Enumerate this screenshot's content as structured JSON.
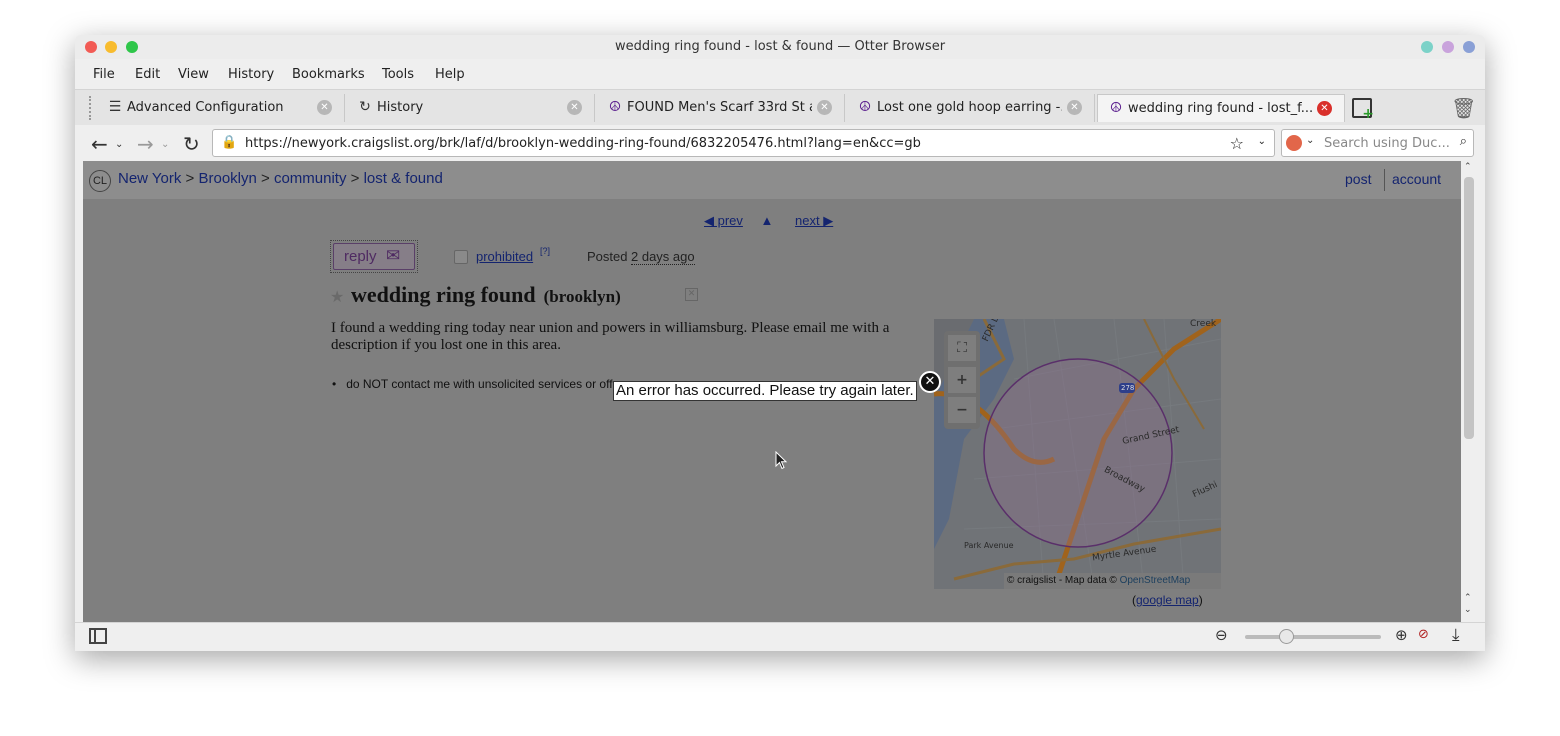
{
  "window": {
    "title": "wedding ring found - lost & found — Otter Browser"
  },
  "menu": [
    "File",
    "Edit",
    "View",
    "History",
    "Bookmarks",
    "Tools",
    "Help"
  ],
  "tabs": [
    {
      "label": "Advanced Configuration",
      "icon": "sliders-icon"
    },
    {
      "label": "History",
      "icon": "history-icon"
    },
    {
      "label": "FOUND Men's Scarf 33rd St a...",
      "icon": "peace-icon"
    },
    {
      "label": "Lost one gold hoop earring -...",
      "icon": "peace-icon"
    },
    {
      "label": "wedding ring found - lost_f...",
      "icon": "peace-icon"
    }
  ],
  "nav": {
    "url": "https://newyork.craigslist.org/brk/laf/d/brooklyn-wedding-ring-found/6832205476.html?lang=en&cc=gb",
    "search_placeholder": "Search using Duc..."
  },
  "page": {
    "logo": "CL",
    "breadcrumb": [
      "New York",
      "Brooklyn",
      "community",
      "lost & found"
    ],
    "header_links": [
      "post",
      "account"
    ],
    "pagination": {
      "prev": "◀ prev",
      "up": "▲",
      "next": "next ▶"
    },
    "reply": "reply",
    "prohibited": "prohibited",
    "prohibited_sup": "[?]",
    "posted_label": "Posted",
    "posted_time": "2 days ago",
    "title": "wedding ring found",
    "location": "(brooklyn)",
    "body": "I found a wedding ring today near union and powers in williamsburg. Please email me with a description if you lost one in this area.",
    "notice": "do NOT contact me with unsolicited services or offers",
    "map": {
      "labels": [
        "FDR Drive",
        "278",
        "Grand Street",
        "Broadway",
        "Flushi",
        "Myrtle Avenue",
        "Park Avenue",
        "Creek"
      ],
      "attribution": "© craigslist - Map data ©",
      "osm": "OpenStreetMap",
      "google_open": "(",
      "google": "google map",
      "google_close": ")"
    },
    "error": "An error has occurred. Please try again later."
  }
}
